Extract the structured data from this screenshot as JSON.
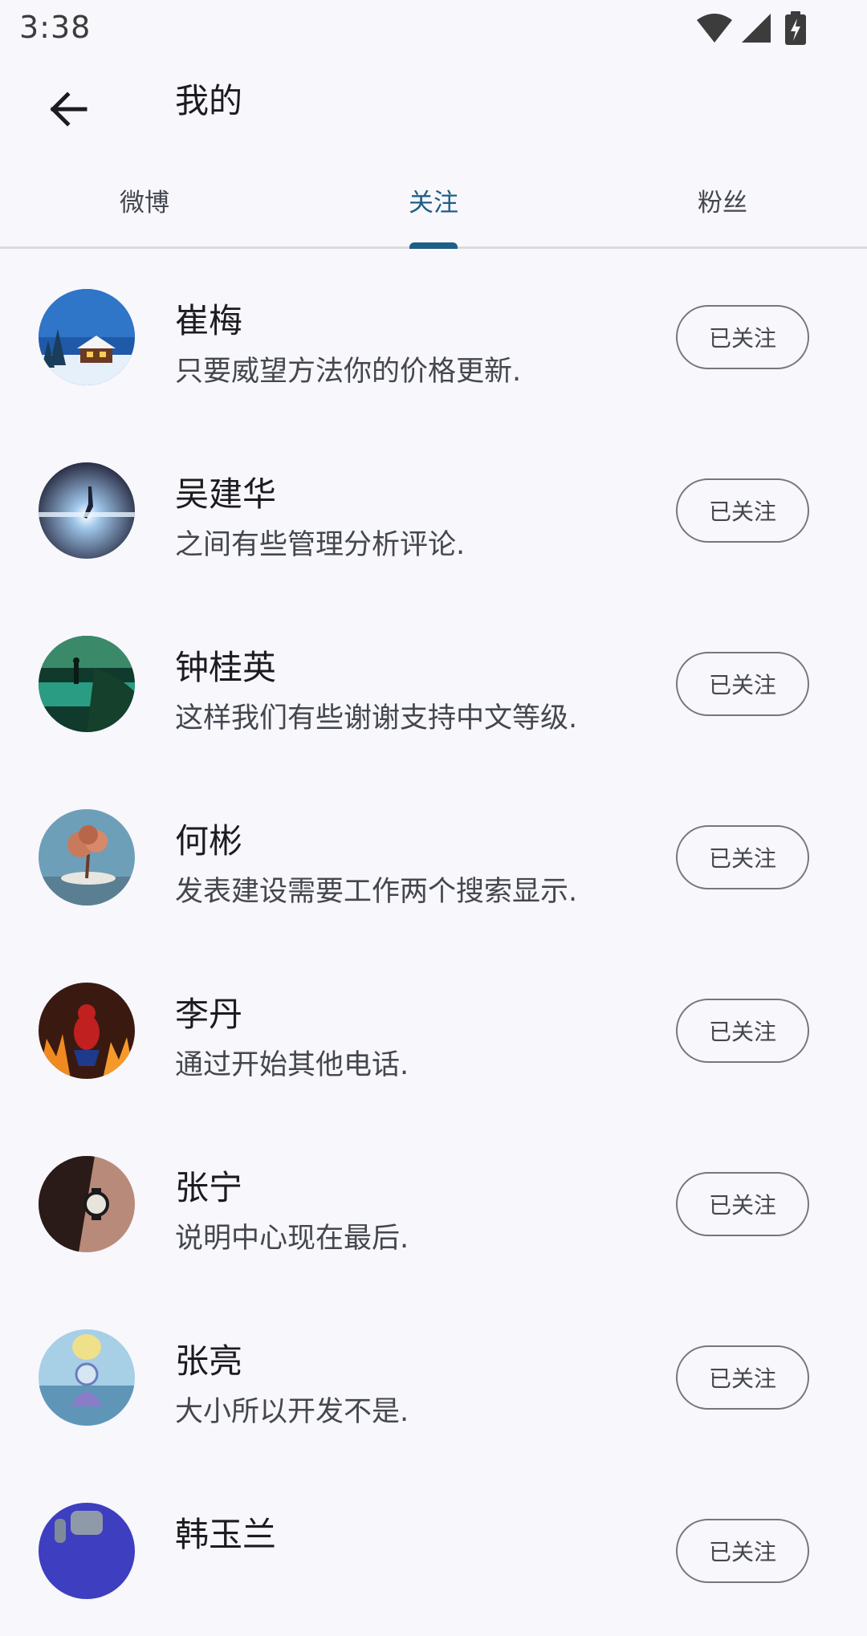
{
  "status_bar": {
    "time": "3:38"
  },
  "app_bar": {
    "title": "我的"
  },
  "tabs": [
    {
      "label": "微博",
      "active": false
    },
    {
      "label": "关注",
      "active": true
    },
    {
      "label": "粉丝",
      "active": false
    }
  ],
  "colors": {
    "accent": "#1f5e86",
    "background": "#f7f7fc"
  },
  "following": [
    {
      "name": "崔梅",
      "bio": "只要威望方法你的价格更新.",
      "button": "已关注",
      "avatar": "snowy-cabin-night"
    },
    {
      "name": "吴建华",
      "bio": "之间有些管理分析评论.",
      "button": "已关注",
      "avatar": "glowing-figure"
    },
    {
      "name": "钟桂英",
      "bio": "这样我们有些谢谢支持中文等级.",
      "button": "已关注",
      "avatar": "lake-figure"
    },
    {
      "name": "何彬",
      "bio": "发表建设需要工作两个搜索显示.",
      "button": "已关注",
      "avatar": "autumn-tree"
    },
    {
      "name": "李丹",
      "bio": "通过开始其他电话.",
      "button": "已关注",
      "avatar": "spiderman-fire"
    },
    {
      "name": "张宁",
      "bio": "说明中心现在最后.",
      "button": "已关注",
      "avatar": "wristwatch"
    },
    {
      "name": "张亮",
      "bio": "大小所以开发不是.",
      "button": "已关注",
      "avatar": "surreal-figure"
    },
    {
      "name": "韩玉兰",
      "bio": "",
      "button": "已关注",
      "avatar": "robot-blue"
    }
  ]
}
